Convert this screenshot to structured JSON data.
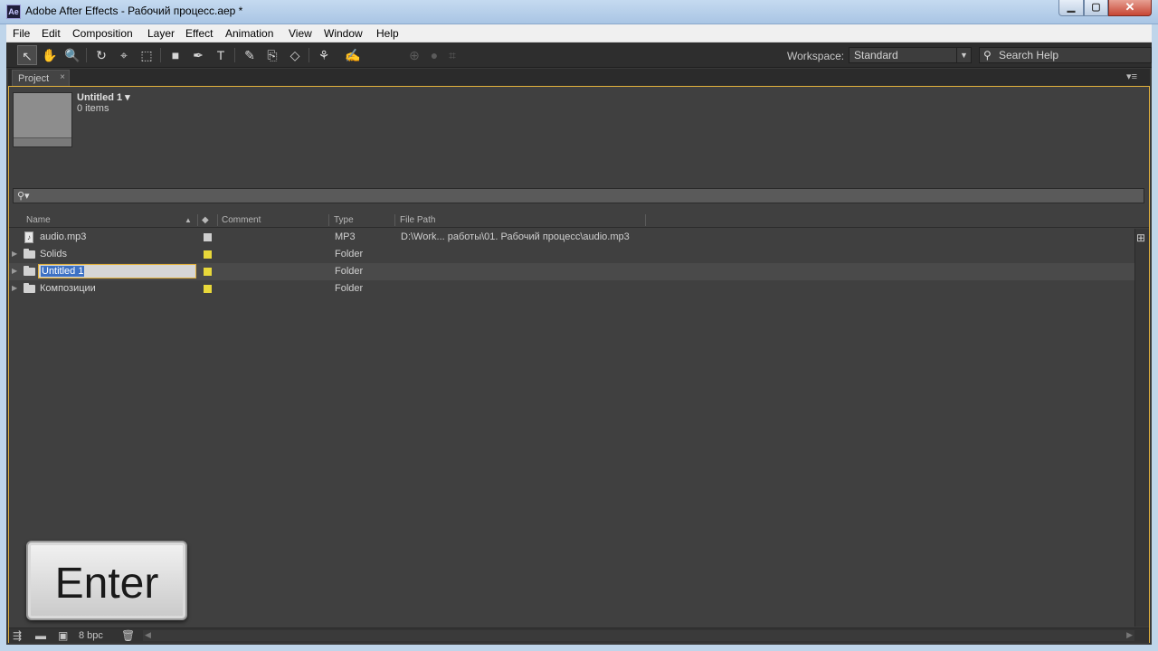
{
  "window": {
    "title": "Adobe After Effects - Рабочий процесс.aep *",
    "app_icon_label": "Ae",
    "min_glyph": "▁",
    "max_glyph": "▢",
    "close_glyph": "✕"
  },
  "menu": [
    "File",
    "Edit",
    "Composition",
    "Layer",
    "Effect",
    "Animation",
    "View",
    "Window",
    "Help"
  ],
  "toolbar": {
    "workspace_label": "Workspace:",
    "workspace_value": "Standard",
    "search_help": "Search Help",
    "search_icon": "⚲",
    "dropdown_glyph": "▼"
  },
  "panel": {
    "tab_label": "Project",
    "close_glyph": "×",
    "menu_glyph": "▾≡",
    "project_name": "Untitled 1 ▾",
    "item_count": "0 items",
    "filter_icon": "⚲▾",
    "columns": {
      "name": "Name",
      "sort_glyph": "▲",
      "label_icon": "◆",
      "comment": "Comment",
      "type": "Type",
      "file_path": "File Path"
    },
    "rows": [
      {
        "name": "audio.mp3",
        "type": "MP3",
        "path": "D:\\Work... работы\\01. Рабочий процесс\\audio.mp3",
        "label_color": "#cfcfcf",
        "icon": "audio-file-icon"
      },
      {
        "name": "Solids",
        "type": "Folder",
        "path": "",
        "label_color": "#e8d83a",
        "icon": "folder-icon"
      },
      {
        "name": "Untitled 1",
        "type": "Folder",
        "path": "",
        "label_color": "#e8d83a",
        "icon": "folder-icon",
        "editing": true
      },
      {
        "name": "Композиции",
        "type": "Folder",
        "path": "",
        "label_color": "#e8d83a",
        "icon": "folder-icon"
      }
    ],
    "twisty_glyph": "▶",
    "audio_glyph": "♪",
    "flowchart_glyph": "⊞"
  },
  "bottombar": {
    "bpc": "8 bpc",
    "interpret_glyph": "⇶",
    "folder_glyph": "▬",
    "comp_glyph": "▣",
    "trash_glyph": "🗑",
    "scroll_left": "◀",
    "scroll_right": "▶"
  },
  "overlay": {
    "key_label": "Enter"
  },
  "tools": [
    "↖",
    "✋",
    "🔍",
    "↻",
    "⌖",
    "⬚",
    "■",
    "✒",
    "T",
    "✎",
    "⎘",
    "◇",
    "⚘",
    "✍"
  ]
}
